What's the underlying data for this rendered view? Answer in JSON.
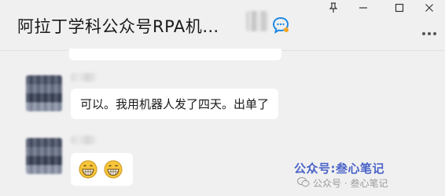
{
  "header": {
    "title": "阿拉丁学科公众号RPA机…",
    "pin_label": "pin-window",
    "minimize_label": "minimize",
    "maximize_label": "maximize",
    "close_label": "close"
  },
  "messages": [
    {
      "sender": "contact",
      "text": "可以。我用机器人发了四天。出单了"
    },
    {
      "sender": "contact",
      "emoji": [
        "grinning-face",
        "grinning-face"
      ]
    }
  ],
  "watermark": {
    "main": "公众号:叁心笔记",
    "sub": "公众号 · 叁心笔记"
  },
  "colors": {
    "background": "#f0f0f0",
    "bubble": "#ffffff",
    "watermark": "#4a63c8",
    "chat_icon": "#1e88e5"
  }
}
